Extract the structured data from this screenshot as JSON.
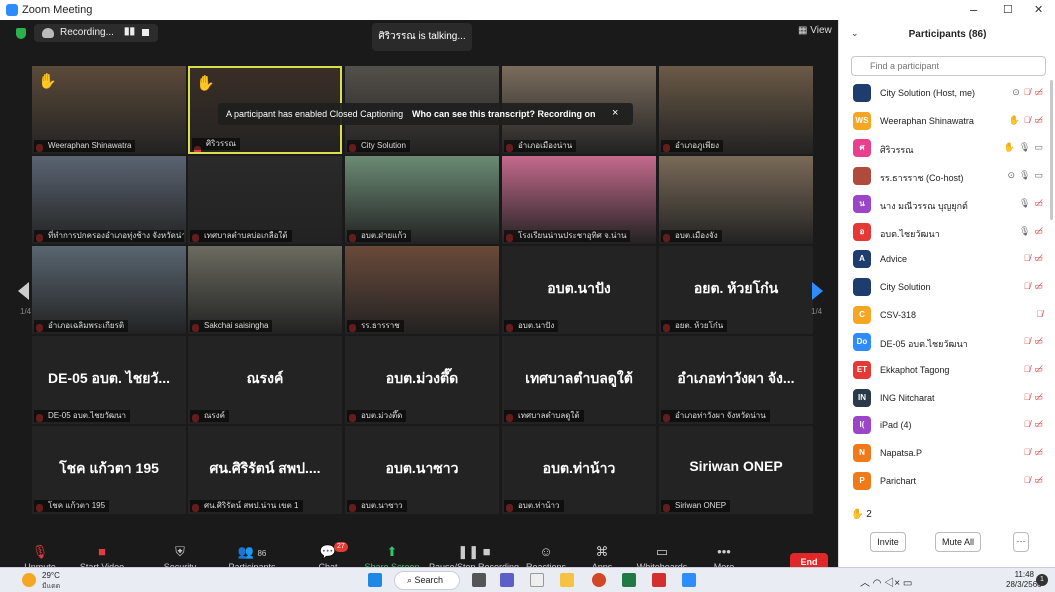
{
  "window": {
    "title": "Zoom Meeting",
    "minimize": "–",
    "restore": "☐",
    "close": "✕"
  },
  "topbar": {
    "recording_label": "Recording...",
    "pause": "▮▮",
    "talking": "ศิริวรรณ is talking...",
    "view_label": "View"
  },
  "caption": {
    "text": "A participant has enabled Closed Captioning",
    "question": "Who can see this transcript? Recording on",
    "close": "×"
  },
  "page": {
    "left_num": "1/4",
    "right_num": "1/4"
  },
  "tiles": [
    {
      "name": "Weeraphan Shinawatra",
      "big": "",
      "hand": true
    },
    {
      "name": "ศิริวรรณ",
      "big": "",
      "hand": true
    },
    {
      "name": "City Solution",
      "big": ""
    },
    {
      "name": "อำเภอเมืองน่าน",
      "big": ""
    },
    {
      "name": "อำเภอภูเพียง",
      "big": ""
    },
    {
      "name": "ที่ทำการปกครองอำเภอทุ่งช้าง จังหวัดน่าน",
      "big": ""
    },
    {
      "name": "เทศบาลตำบลบ่อเกลือใต้",
      "big": ""
    },
    {
      "name": "อบต.ฝายแก้ว",
      "big": ""
    },
    {
      "name": "โรงเรียนน่านประชาอุทิศ จ.น่าน",
      "big": ""
    },
    {
      "name": "อบต.เมืองจัง",
      "big": ""
    },
    {
      "name": "อำเภอเฉลิมพระเกียรติ",
      "big": ""
    },
    {
      "name": "Sakchai saisingha",
      "big": ""
    },
    {
      "name": "รร.ธารราช",
      "big": ""
    },
    {
      "name": "อบต.นาปัง",
      "big": "อบต.นาปัง"
    },
    {
      "name": "อยต. ห้วยโก๋น",
      "big": "อยต. ห้วยโก๋น"
    },
    {
      "name": "DE-05 อบต.ไชยวัฒนา",
      "big": "DE-05 อบต. ไชยวั..."
    },
    {
      "name": "ณรงค์",
      "big": "ณรงค์"
    },
    {
      "name": "อบต.ม่วงตึ๊ด",
      "big": "อบต.ม่วงตึ๊ด"
    },
    {
      "name": "เทศบาลตำบลดูใต้",
      "big": "เทศบาลตำบลดูใต้"
    },
    {
      "name": "อำเภอท่าวังผา จังหวัดน่าน",
      "big": "อำเภอท่าวังผา จัง..."
    },
    {
      "name": "โชค แก้วตา 195",
      "big": "โชค แก้วตา 195"
    },
    {
      "name": "ศน.ศิริรัตน์ สพป.น่าน เขต 1",
      "big": "ศน.ศิริรัตน์ สพป...."
    },
    {
      "name": "อบต.นาซาว",
      "big": "อบต.นาซาว"
    },
    {
      "name": "อบต.ท่าน้าว",
      "big": "อบต.ท่าน้าว"
    },
    {
      "name": "Siriwan ONEP",
      "big": "Siriwan ONEP"
    }
  ],
  "toolbar": {
    "unmute": "Unmute",
    "start_video": "Start Video",
    "security": "Security",
    "participants": "Participants",
    "participants_count": "86",
    "chat": "Chat",
    "chat_badge": "27",
    "share_screen": "Share Screen",
    "pause_stop": "Pause/Stop Recording",
    "reactions": "Reactions",
    "apps": "Apps",
    "whiteboards": "Whiteboards",
    "more": "More",
    "end": "End"
  },
  "panel": {
    "title": "Participants (86)",
    "search_placeholder": "Find a participant",
    "raised_count": "2",
    "invite": "Invite",
    "mute_all": "Mute All",
    "more": "···",
    "participants": [
      {
        "name": "City Solution (Host, me)",
        "initials": "",
        "color": "#1f3c6e",
        "hand": false,
        "mic": "muted",
        "video": "off",
        "rec": true
      },
      {
        "name": "Weeraphan Shinawatra",
        "initials": "WS",
        "color": "#f5a623",
        "hand": true,
        "mic": "muted",
        "video": "off"
      },
      {
        "name": "ศิริวรรณ",
        "initials": "ศ",
        "color": "#e8408c",
        "hand": true,
        "mic": "on",
        "video": "on"
      },
      {
        "name": "รร.ธารราช (Co-host)",
        "initials": "",
        "color": "#b04a3c",
        "hand": false,
        "mic": "on",
        "video": "on",
        "rec": true
      },
      {
        "name": "นาง มณีวรรณ บุญยุกต์",
        "initials": "น",
        "color": "#9b45c9",
        "hand": false,
        "mic": "on",
        "video": "off"
      },
      {
        "name": "อบต.ไชยวัฒนา",
        "initials": "อ",
        "color": "#e53935",
        "hand": false,
        "mic": "on",
        "video": "off"
      },
      {
        "name": "Advice",
        "initials": "A",
        "color": "#1f3c6e",
        "hand": false,
        "mic": "muted",
        "video": "off"
      },
      {
        "name": "City Solution",
        "initials": "",
        "color": "#1f3c6e",
        "hand": false,
        "mic": "muted",
        "video": "off"
      },
      {
        "name": "CSV-318",
        "initials": "C",
        "color": "#f5a623",
        "hand": false,
        "mic": "muted",
        "video": ""
      },
      {
        "name": "DE-05 อบต.ไชยวัฒนา",
        "initials": "Do",
        "color": "#2d8cff",
        "hand": false,
        "mic": "muted",
        "video": "off"
      },
      {
        "name": "Ekkaphot Tagong",
        "initials": "ET",
        "color": "#e53935",
        "hand": false,
        "mic": "muted",
        "video": "off"
      },
      {
        "name": "ING Nitcharat",
        "initials": "IN",
        "color": "#2b3a4a",
        "hand": false,
        "mic": "muted",
        "video": "off"
      },
      {
        "name": "iPad (4)",
        "initials": "I(",
        "color": "#9b45c9",
        "hand": false,
        "mic": "muted",
        "video": "off"
      },
      {
        "name": "Napatsa.P",
        "initials": "N",
        "color": "#f07a1a",
        "hand": false,
        "mic": "muted",
        "video": "off"
      },
      {
        "name": "Parichart",
        "initials": "P",
        "color": "#f07a1a",
        "hand": false,
        "mic": "muted",
        "video": "off"
      }
    ]
  },
  "taskbar": {
    "temp": "29°C",
    "condition": "มีแดด",
    "search": "Search",
    "time": "11:48",
    "date": "28/3/2566",
    "notif": "1"
  }
}
